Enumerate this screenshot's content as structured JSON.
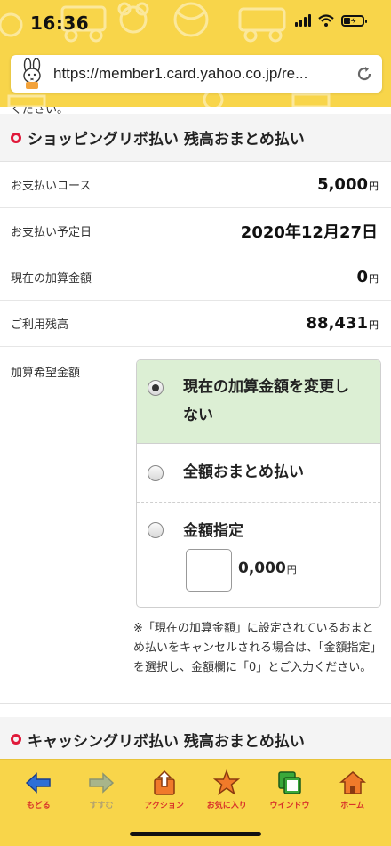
{
  "status_bar": {
    "time": "16:36",
    "battery_level": 0.35
  },
  "browser": {
    "url": "https://member1.card.yahoo.co.jp/re..."
  },
  "page": {
    "cut_text": "ください。",
    "section1": {
      "title": "ショッピングリボ払い 残高おまとめ払い",
      "rows": [
        {
          "label": "お支払いコース",
          "value": "5,000",
          "unit": "円"
        },
        {
          "label": "お支払い予定日",
          "value": "2020年12月27日",
          "unit": ""
        },
        {
          "label": "現在の加算金額",
          "value": "0",
          "unit": "円"
        },
        {
          "label": "ご利用残高",
          "value": "88,431",
          "unit": "円"
        }
      ],
      "hope_label": "加算希望金額",
      "options": [
        {
          "label_line1": "現在の加算金額を変更し",
          "label_line2": "ない",
          "selected": true
        },
        {
          "label": "全額おまとめ払い",
          "selected": false
        },
        {
          "label": "金額指定",
          "selected": false,
          "input_value": "",
          "fixed_suffix": "0,000",
          "unit": "円"
        }
      ],
      "note": "※「現在の加算金額」に設定されているおまとめ払いをキャンセルされる場合は、「金額指定」を選択し、金額欄に「0」とご入力ください。"
    },
    "section2": {
      "title": "キャッシングリボ払い 残高おまとめ払い"
    }
  },
  "toolbar": {
    "items": [
      {
        "label": "もどる",
        "icon": "back-arrow-icon",
        "enabled": true
      },
      {
        "label": "すすむ",
        "icon": "forward-arrow-icon",
        "enabled": false
      },
      {
        "label": "アクション",
        "icon": "share-icon",
        "enabled": true
      },
      {
        "label": "お気に入り",
        "icon": "star-icon",
        "enabled": true
      },
      {
        "label": "ウインドウ",
        "icon": "windows-icon",
        "enabled": true
      },
      {
        "label": "ホーム",
        "icon": "home-icon",
        "enabled": true
      }
    ]
  },
  "colors": {
    "accent_yellow": "#f8d54a",
    "bullet_red": "#e0193a",
    "selected_green": "#dcefd4"
  }
}
